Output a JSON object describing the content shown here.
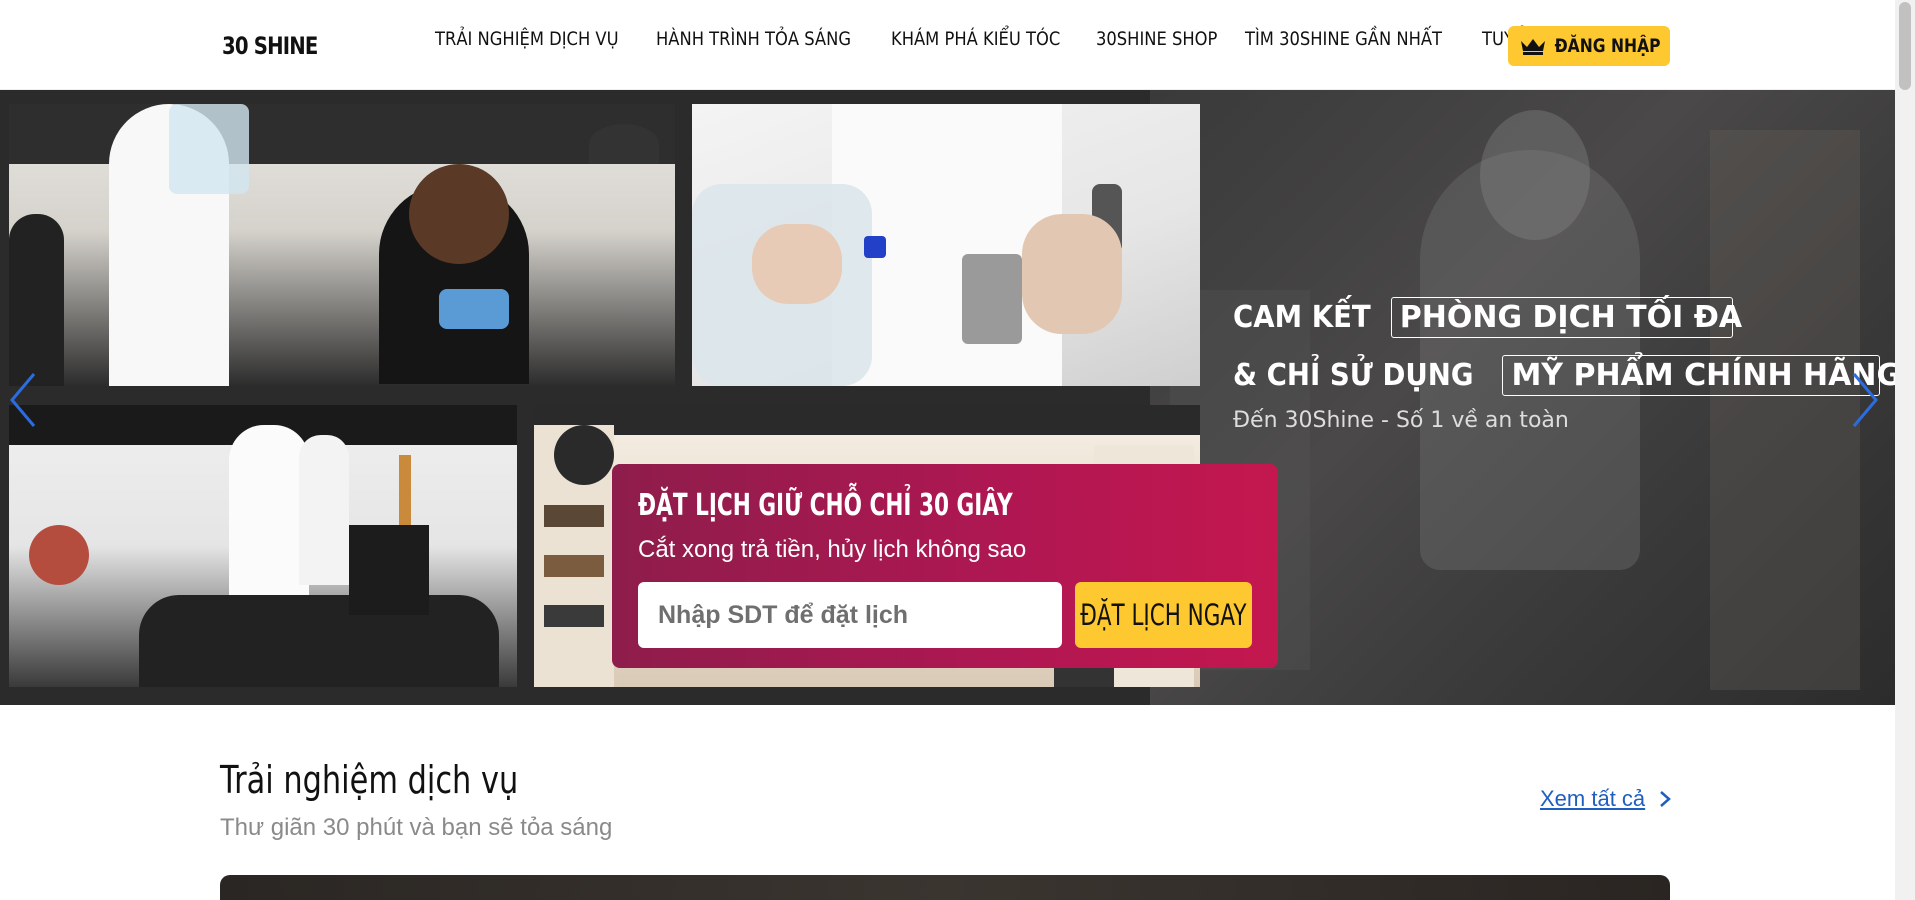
{
  "header": {
    "logo_text": "30 SHINE",
    "nav": [
      {
        "label": "TRẢI NGHIỆM DỊCH VỤ"
      },
      {
        "label": "HÀNH TRÌNH TỎA SÁNG"
      },
      {
        "label": "KHÁM PHÁ KIỂU TÓC"
      },
      {
        "label": "30SHINE SHOP"
      },
      {
        "label": "TÌM 30SHINE GẦN NHẤT"
      },
      {
        "label": "TUYỂN DỤNG"
      }
    ],
    "login_label": "ĐĂNG NHẬP",
    "login_icon": "crown-icon"
  },
  "hero": {
    "line1_prefix": "CAM KẾT",
    "line1_box": "PHÒNG DỊCH TỐI ĐA",
    "line2_prefix": "& CHỈ SỬ DỤNG",
    "line2_box": "MỸ PHẨM CHÍNH HÃNG",
    "subtitle": "Đến 30Shine - Số 1 về an toàn",
    "prev_icon": "chevron-left-icon",
    "next_icon": "chevron-right-icon"
  },
  "booking": {
    "title": "ĐẶT LỊCH GIỮ CHỖ CHỈ 30 GIÂY",
    "subtitle": "Cắt xong trả tiền, hủy lịch không sao",
    "input_placeholder": "Nhập SDT để đặt lịch",
    "input_value": "",
    "button_label": "ĐẶT LỊCH NGAY"
  },
  "services": {
    "title": "Trải nghiệm dịch vụ",
    "subtitle": "Thư giãn 30 phút và bạn sẽ tỏa sáng",
    "see_all_label": "Xem tất cả"
  },
  "colors": {
    "accent_yellow": "#fdc830",
    "booking_magenta": "#b01752",
    "link_blue": "#1f5fbf",
    "arrow_blue": "#2b6de0"
  }
}
